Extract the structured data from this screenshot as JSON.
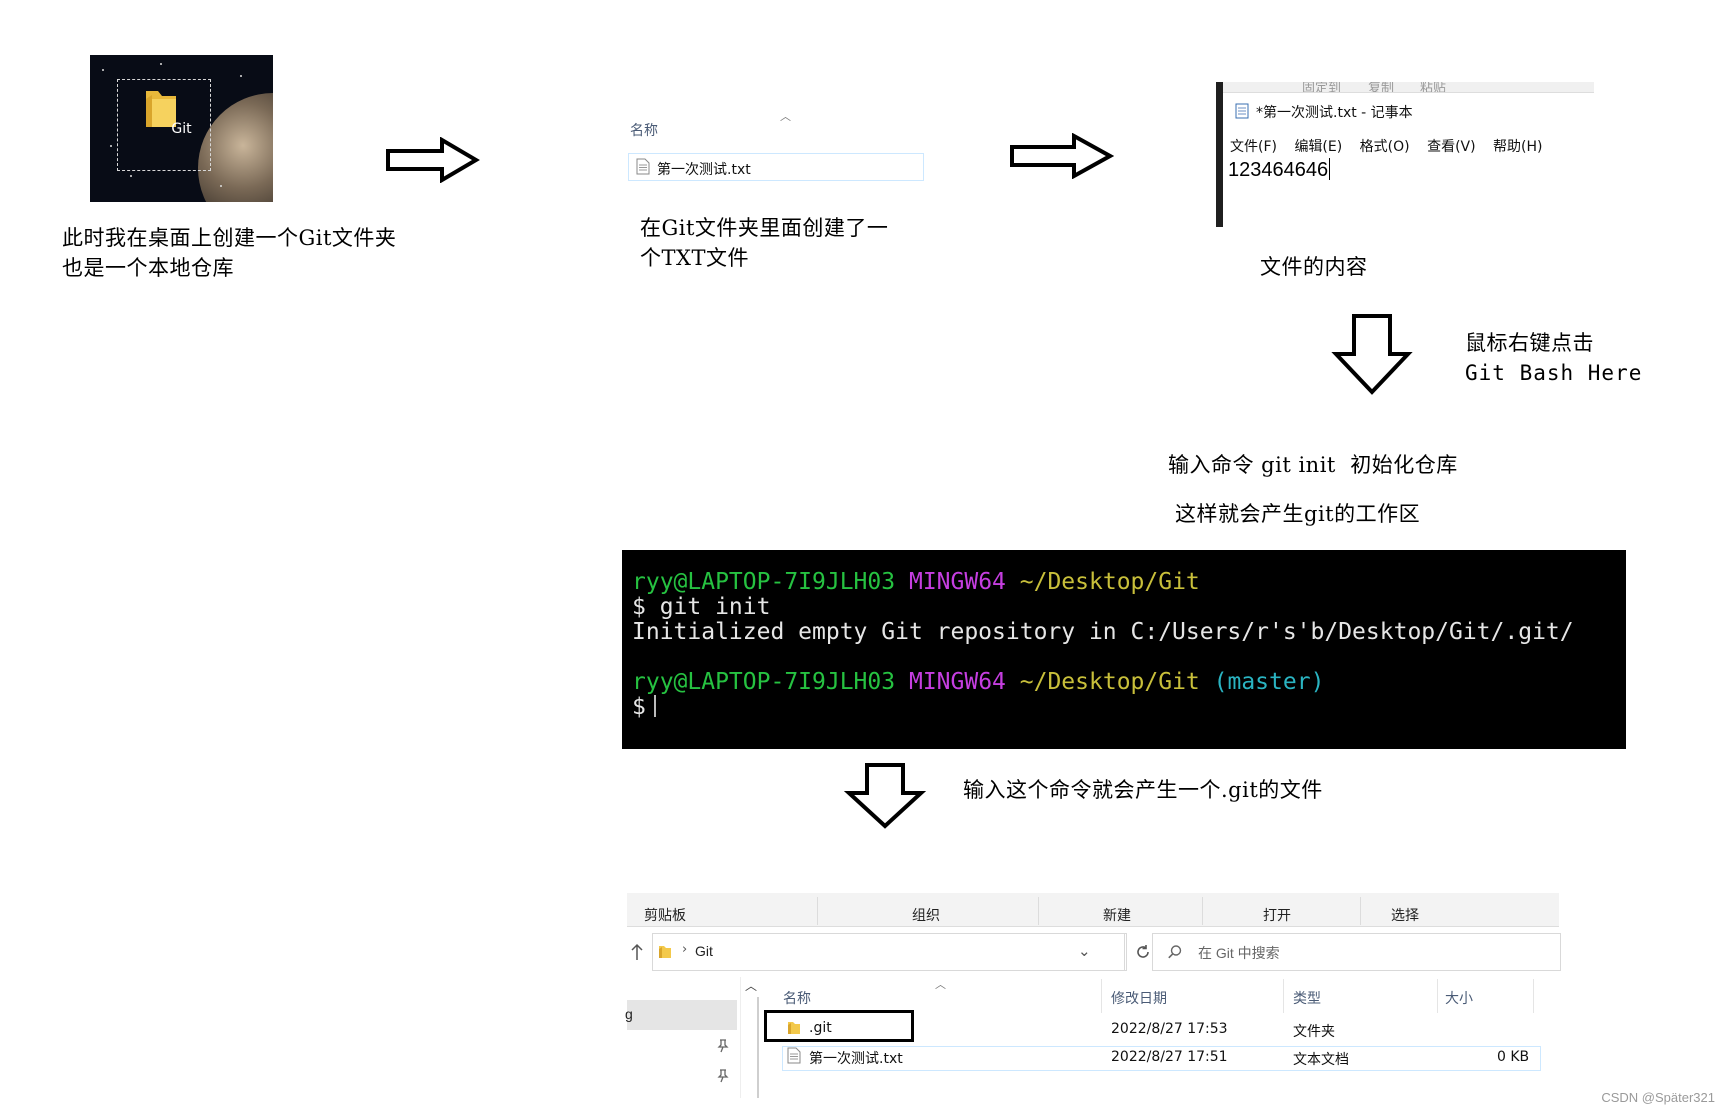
{
  "desktop": {
    "folder_label": "Git"
  },
  "captions": {
    "step1_line1": "此时我在桌面上创建一个Git文件夹",
    "step1_line2": "也是一个本地仓库",
    "step2_line1": "在Git文件夹里面创建了一",
    "step2_line2": "个TXT文件",
    "step3": "文件的内容",
    "step4_line1": "鼠标右键点击",
    "step4_line2": "Git Bash Here",
    "step5_line1": "输入命令 git init  初始化仓库",
    "step5_line2": "这样就会产生git的工作区",
    "step6": "输入这个命令就会产生一个.git的文件"
  },
  "explorer_small": {
    "column_name": "名称",
    "file": "第一次测试.txt"
  },
  "notepad": {
    "ribbon_fragments": [
      "固定到",
      "复制",
      "粘贴"
    ],
    "title": "*第一次测试.txt - 记事本",
    "menu": [
      "文件(F)",
      "编辑(E)",
      "格式(O)",
      "查看(V)",
      "帮助(H)"
    ],
    "content": "123464646"
  },
  "terminal": {
    "user_host": "ryy@LAPTOP-7I9JLH03",
    "env": "MINGW64",
    "path": "~/Desktop/Git",
    "branch": "(master)",
    "prompt": "$",
    "command": "$ git init",
    "output": "Initialized empty Git repository in C:/Users/r's'b/Desktop/Git/.git/"
  },
  "explorer": {
    "ribbon_groups": [
      "剪贴板",
      "组织",
      "新建",
      "打开",
      "选择"
    ],
    "address": "Git",
    "search_placeholder": "在 Git 中搜索",
    "columns": [
      "名称",
      "修改日期",
      "类型",
      "大小"
    ],
    "sidebar_fragment": "g",
    "rows": [
      {
        "name": ".git",
        "date": "2022/8/27 17:53",
        "type": "文件夹",
        "size": ""
      },
      {
        "name": "第一次测试.txt",
        "date": "2022/8/27 17:51",
        "type": "文本文档",
        "size": "0 KB"
      }
    ]
  },
  "watermark": "CSDN @Später321"
}
